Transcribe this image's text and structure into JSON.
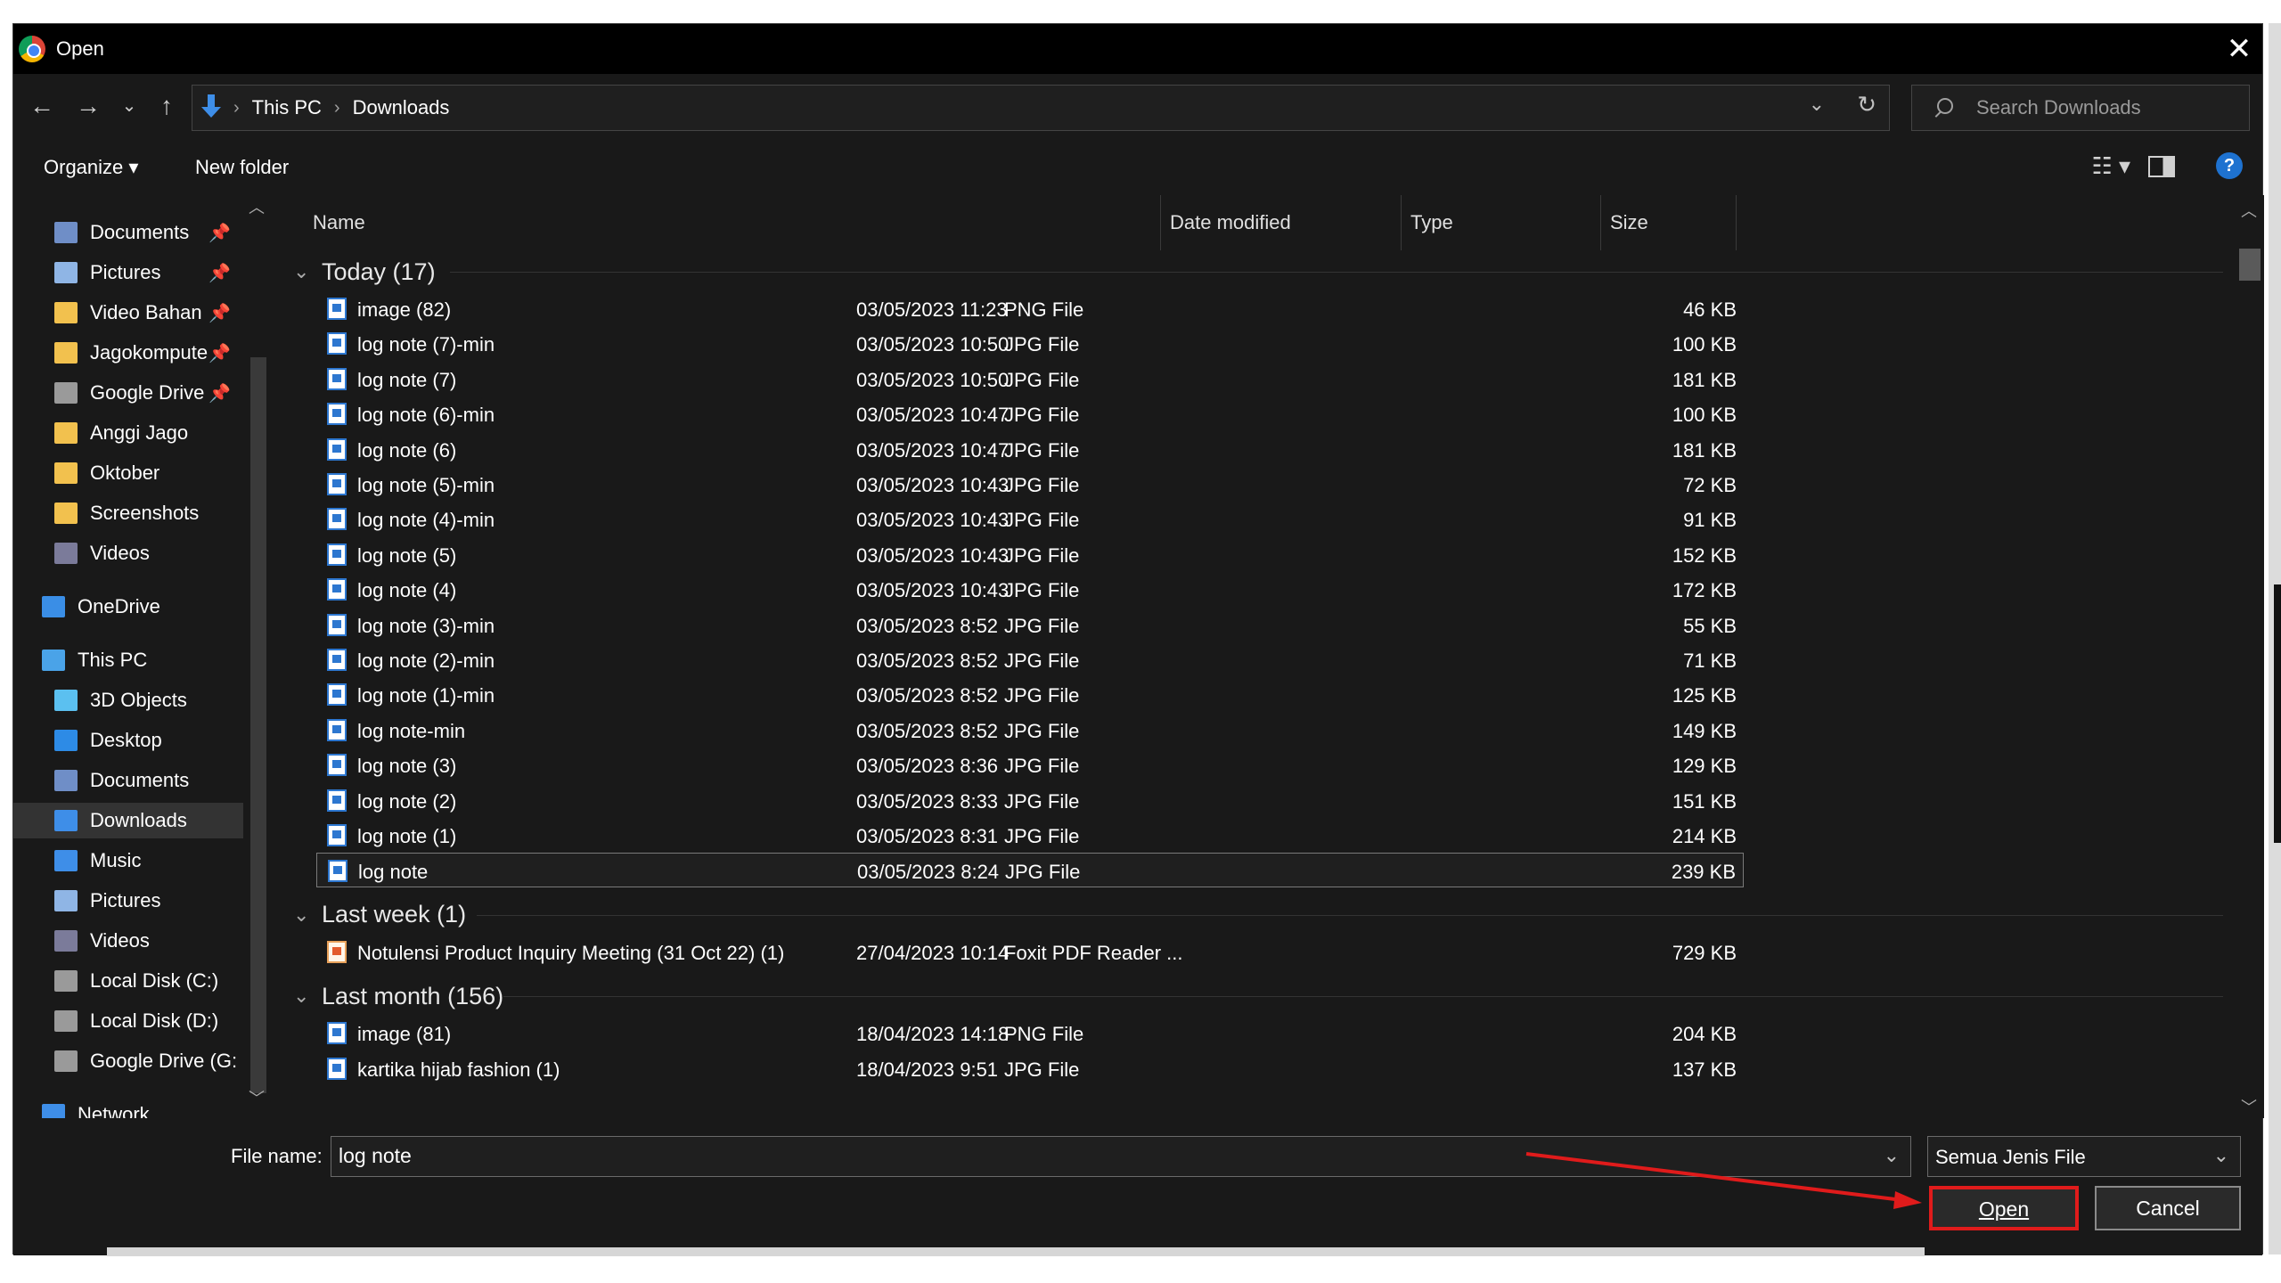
{
  "window": {
    "title": "Open",
    "close_glyph": "✕"
  },
  "nav": {
    "back": "←",
    "forward": "→",
    "recent": "⌄",
    "up": "↑",
    "breadcrumbs": [
      "This PC",
      "Downloads"
    ],
    "breadcrumb_sep": "›",
    "dropdown": "⌄",
    "refresh": "↻"
  },
  "search": {
    "placeholder": "Search Downloads"
  },
  "toolbar": {
    "organize": "Organize ▾",
    "new_folder": "New folder",
    "view_menu": "☷ ▾",
    "help": "?"
  },
  "sidebar": {
    "items": [
      {
        "label": "Documents",
        "icon": "documents-icon",
        "color": "#6f8ec7",
        "pinned": true
      },
      {
        "label": "Pictures",
        "icon": "pictures-icon",
        "color": "#8fb5e5",
        "pinned": true
      },
      {
        "label": "Video Bahan",
        "icon": "folder-icon",
        "color": "#f2c14e",
        "pinned": true
      },
      {
        "label": "Jagokompute",
        "icon": "folder-icon",
        "color": "#f2c14e",
        "pinned": true
      },
      {
        "label": "Google Drive",
        "icon": "drive-icon",
        "color": "#9a9a9a",
        "pinned": true
      },
      {
        "label": "Anggi Jago",
        "icon": "folder-icon",
        "color": "#f2c14e",
        "pinned": false
      },
      {
        "label": "Oktober",
        "icon": "folder-icon",
        "color": "#f2c14e",
        "pinned": false
      },
      {
        "label": "Screenshots",
        "icon": "folder-icon",
        "color": "#f2c14e",
        "pinned": false
      },
      {
        "label": "Videos",
        "icon": "videos-icon",
        "color": "#7b7b9a",
        "pinned": false
      },
      {
        "label": "OneDrive",
        "icon": "onedrive-icon",
        "color": "#3a8ee6",
        "pinned": false
      },
      {
        "label": "This PC",
        "icon": "computer-icon",
        "color": "#4aa3e8",
        "pinned": false
      },
      {
        "label": "3D Objects",
        "icon": "3d-objects-icon",
        "color": "#5bc0f0",
        "pinned": false
      },
      {
        "label": "Desktop",
        "icon": "desktop-icon",
        "color": "#2d8be6",
        "pinned": false
      },
      {
        "label": "Documents",
        "icon": "documents-icon",
        "color": "#6f8ec7",
        "pinned": false
      },
      {
        "label": "Downloads",
        "icon": "downloads-icon",
        "color": "#3e8ee8",
        "pinned": false
      },
      {
        "label": "Music",
        "icon": "music-icon",
        "color": "#3e8ee8",
        "pinned": false
      },
      {
        "label": "Pictures",
        "icon": "pictures-icon",
        "color": "#8fb5e5",
        "pinned": false
      },
      {
        "label": "Videos",
        "icon": "videos-icon",
        "color": "#7b7b9a",
        "pinned": false
      },
      {
        "label": "Local Disk (C:)",
        "icon": "disk-icon",
        "color": "#9a9a9a",
        "pinned": false
      },
      {
        "label": "Local Disk (D:)",
        "icon": "disk-icon",
        "color": "#9a9a9a",
        "pinned": false
      },
      {
        "label": "Google Drive (G:",
        "icon": "drive-icon",
        "color": "#9a9a9a",
        "pinned": false
      },
      {
        "label": "Network",
        "icon": "network-icon",
        "color": "#3e8ee8",
        "pinned": false
      }
    ],
    "selected_label": "Downloads",
    "pin_glyph": "📌"
  },
  "columns": {
    "name": "Name",
    "date": "Date modified",
    "type": "Type",
    "size": "Size"
  },
  "groups": [
    {
      "label": "Today (17)",
      "rows": [
        {
          "name": "image (82)",
          "date": "03/05/2023 11:23",
          "type": "PNG File",
          "size": "46 KB"
        },
        {
          "name": "log note (7)-min",
          "date": "03/05/2023 10:50",
          "type": "JPG File",
          "size": "100 KB"
        },
        {
          "name": "log note (7)",
          "date": "03/05/2023 10:50",
          "type": "JPG File",
          "size": "181 KB"
        },
        {
          "name": "log note (6)-min",
          "date": "03/05/2023 10:47",
          "type": "JPG File",
          "size": "100 KB"
        },
        {
          "name": "log note (6)",
          "date": "03/05/2023 10:47",
          "type": "JPG File",
          "size": "181 KB"
        },
        {
          "name": "log note (5)-min",
          "date": "03/05/2023 10:43",
          "type": "JPG File",
          "size": "72 KB"
        },
        {
          "name": "log note (4)-min",
          "date": "03/05/2023 10:43",
          "type": "JPG File",
          "size": "91 KB"
        },
        {
          "name": "log note (5)",
          "date": "03/05/2023 10:43",
          "type": "JPG File",
          "size": "152 KB"
        },
        {
          "name": "log note (4)",
          "date": "03/05/2023 10:43",
          "type": "JPG File",
          "size": "172 KB"
        },
        {
          "name": "log note (3)-min",
          "date": "03/05/2023 8:52",
          "type": "JPG File",
          "size": "55 KB"
        },
        {
          "name": "log note (2)-min",
          "date": "03/05/2023 8:52",
          "type": "JPG File",
          "size": "71 KB"
        },
        {
          "name": "log note (1)-min",
          "date": "03/05/2023 8:52",
          "type": "JPG File",
          "size": "125 KB"
        },
        {
          "name": "log note-min",
          "date": "03/05/2023 8:52",
          "type": "JPG File",
          "size": "149 KB"
        },
        {
          "name": "log note (3)",
          "date": "03/05/2023 8:36",
          "type": "JPG File",
          "size": "129 KB"
        },
        {
          "name": "log note (2)",
          "date": "03/05/2023 8:33",
          "type": "JPG File",
          "size": "151 KB"
        },
        {
          "name": "log note (1)",
          "date": "03/05/2023 8:31",
          "type": "JPG File",
          "size": "214 KB"
        },
        {
          "name": "log note",
          "date": "03/05/2023 8:24",
          "type": "JPG File",
          "size": "239 KB",
          "selected": true
        }
      ]
    },
    {
      "label": "Last week (1)",
      "rows": [
        {
          "name": "Notulensi Product Inquiry Meeting (31 Oct 22) (1)",
          "date": "27/04/2023 10:14",
          "type": "Foxit PDF Reader ...",
          "size": "729 KB",
          "pdf": true
        }
      ]
    },
    {
      "label": "Last month (156)",
      "rows": [
        {
          "name": "image (81)",
          "date": "18/04/2023 14:18",
          "type": "PNG File",
          "size": "204 KB"
        },
        {
          "name": "kartika hijab fashion (1)",
          "date": "18/04/2023 9:51",
          "type": "JPG File",
          "size": "137 KB"
        }
      ]
    }
  ],
  "footer": {
    "file_name_label": "File name:",
    "file_name_value": "log note",
    "file_type": "Semua Jenis File",
    "open": "Open",
    "cancel": "Cancel"
  },
  "colors": {
    "annotation_red": "#e01b1b",
    "accent_blue": "#3e8ee8",
    "background": "#191919"
  }
}
